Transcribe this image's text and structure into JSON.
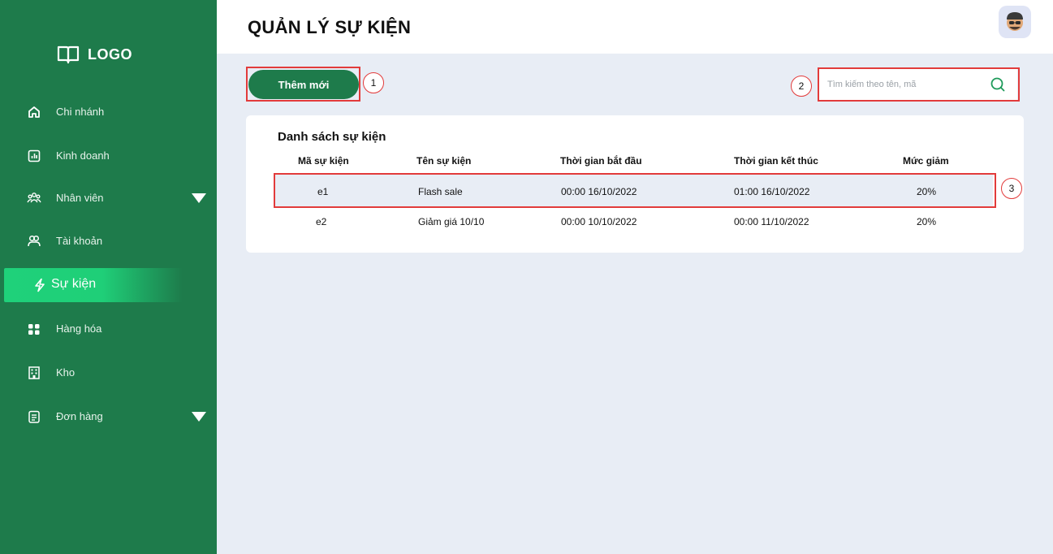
{
  "sidebar": {
    "logo_text": "LOGO",
    "items": [
      {
        "label": "Chi nhánh",
        "icon": "home-icon"
      },
      {
        "label": "Kinh doanh",
        "icon": "chart-icon"
      },
      {
        "label": "Nhân viên",
        "icon": "users-icon",
        "expandable": true
      },
      {
        "label": "Tài khoản",
        "icon": "account-icon"
      },
      {
        "label": "Sự kiện",
        "icon": "lightning-icon",
        "active": true
      },
      {
        "label": "Hàng hóa",
        "icon": "grid-icon"
      },
      {
        "label": "Kho",
        "icon": "building-icon"
      },
      {
        "label": "Đơn hàng",
        "icon": "clipboard-icon",
        "expandable": true
      }
    ]
  },
  "header": {
    "title": "QUẢN LÝ SỰ KIỆN"
  },
  "toolbar": {
    "add_label": "Thêm mới",
    "search_placeholder": "Tìm kiếm theo tên, mã"
  },
  "annotations": {
    "m1": "1",
    "m2": "2",
    "m3": "3"
  },
  "table": {
    "title": "Danh sách sự kiện",
    "columns": [
      "Mã sự kiện",
      "Tên sự kiện",
      "Thời gian bắt đầu",
      "Thời gian kết thúc",
      "Mức giảm"
    ],
    "rows": [
      [
        "e1",
        "Flash sale",
        "00:00 16/10/2022",
        "01:00 16/10/2022",
        "20%"
      ],
      [
        "e2",
        "Giảm giá 10/10",
        "00:00 10/10/2022",
        "00:00 11/10/2022",
        "20%"
      ]
    ]
  },
  "colors": {
    "sidebar": "#1e7b4b",
    "active": "#1fd17a",
    "background": "#e8edf5",
    "annotation": "#e23b3b"
  }
}
